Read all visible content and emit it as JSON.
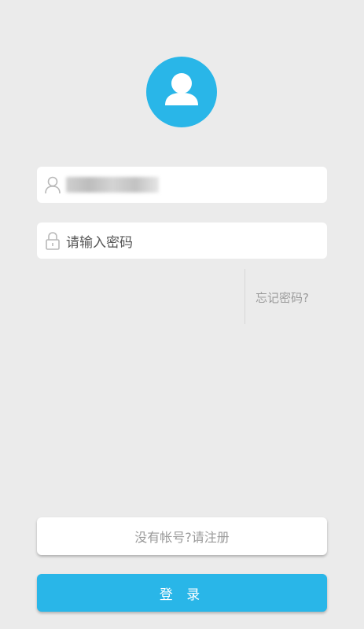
{
  "avatar": {
    "icon": "user-avatar-icon",
    "color": "#29b6e8"
  },
  "login_form": {
    "username": {
      "icon": "user-icon",
      "value_state": "blurred"
    },
    "password": {
      "icon": "lock-icon",
      "placeholder": "请输入密码"
    },
    "forgot_password": "忘记密码?"
  },
  "buttons": {
    "register_label": "没有帐号?请注册",
    "login_label": "登 录"
  },
  "colors": {
    "accent": "#29b6e8",
    "background": "#ebebeb"
  }
}
